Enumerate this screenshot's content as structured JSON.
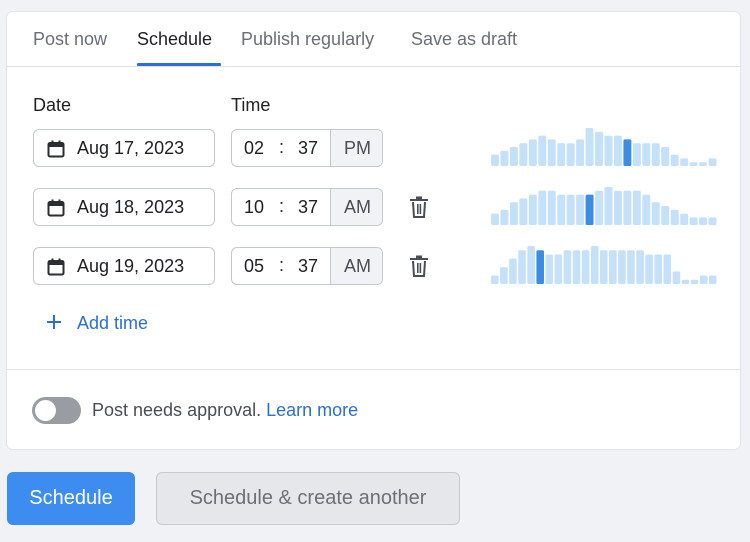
{
  "tabs": [
    {
      "label": "Post now",
      "active": false
    },
    {
      "label": "Schedule",
      "active": true
    },
    {
      "label": "Publish regularly",
      "active": false
    },
    {
      "label": "Save as draft",
      "active": false
    }
  ],
  "columns": {
    "date": "Date",
    "time": "Time"
  },
  "rows": [
    {
      "date": "Aug 17, 2023",
      "hour": "02",
      "minute": "37",
      "ampm": "PM",
      "deletable": false,
      "activity": [
        3,
        4,
        5,
        6,
        7,
        8,
        7,
        6,
        6,
        7,
        10,
        9,
        8,
        8,
        7,
        6,
        6,
        6,
        5,
        3,
        2,
        1,
        1,
        2
      ],
      "highlight": 14
    },
    {
      "date": "Aug 18, 2023",
      "hour": "10",
      "minute": "37",
      "ampm": "AM",
      "deletable": true,
      "activity": [
        3,
        4,
        6,
        7,
        8,
        9,
        9,
        8,
        8,
        8,
        8,
        9,
        10,
        9,
        9,
        9,
        8,
        6,
        5,
        4,
        3,
        2,
        2,
        2
      ],
      "highlight": 10
    },
    {
      "date": "Aug 19, 2023",
      "hour": "05",
      "minute": "37",
      "ampm": "AM",
      "deletable": true,
      "activity": [
        2,
        4,
        6,
        8,
        9,
        8,
        7,
        7,
        8,
        8,
        8,
        9,
        8,
        8,
        8,
        8,
        8,
        7,
        7,
        7,
        3,
        1,
        1,
        2,
        2
      ],
      "highlight": 5
    }
  ],
  "add_time_label": "Add time",
  "approval": {
    "text": "Post needs approval.",
    "link": "Learn more",
    "enabled": false
  },
  "buttons": {
    "primary": "Schedule",
    "secondary": "Schedule & create another"
  },
  "colors": {
    "accent": "#2a70d8",
    "bar": "#c5e1fa",
    "bar_highlight": "#3a8ce4",
    "primary_button": "#3d8cf0"
  }
}
